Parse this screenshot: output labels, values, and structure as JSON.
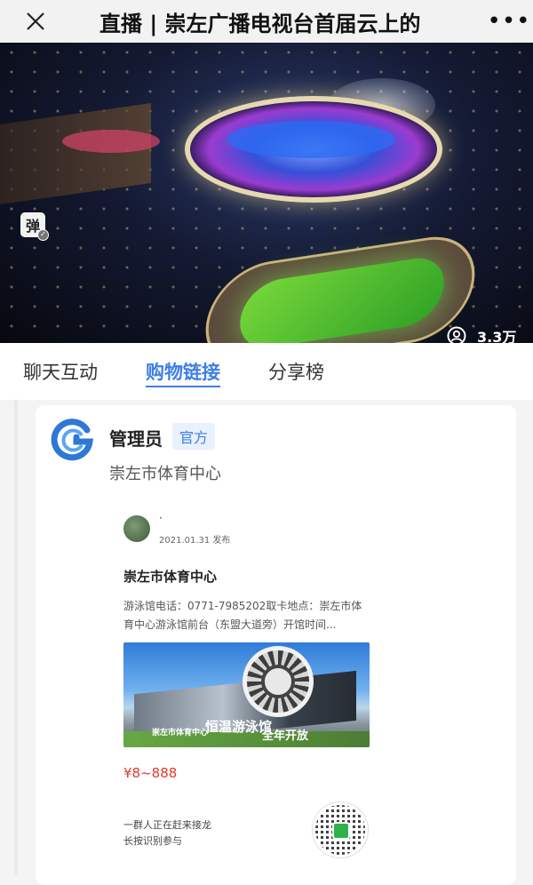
{
  "header": {
    "title": "直播 | 崇左广播电视台首届云上的",
    "close_icon": "close-icon",
    "more_icon": "more-icon"
  },
  "video": {
    "danmu_label": "弹",
    "viewers": "3.3万",
    "viewers_icon": "user-circle-icon"
  },
  "tabs": [
    {
      "label": "聊天互动",
      "active": false
    },
    {
      "label": "购物链接",
      "active": true
    },
    {
      "label": "分享榜",
      "active": false
    }
  ],
  "card": {
    "name": "管理员",
    "badge": "官方",
    "subtitle": "崇左市体育中心",
    "post": {
      "author": "·",
      "date": "2021.01.31 发布",
      "title": "崇左市体育中心",
      "description": "游泳馆电话：0771-7985202取卡地点：崇左市体育中心游泳馆前台（东盟大道旁）开馆时间...",
      "image_caption_small": "崇左市体育中心",
      "image_caption_big": "恒温游泳馆",
      "image_caption_side": "全年开放",
      "price": "¥8~888",
      "footer_line1": "一群人正在赶来接龙",
      "footer_line2": "长按识别参与"
    }
  },
  "colors": {
    "accent": "#3f7ee6",
    "price": "#e03a2e"
  }
}
